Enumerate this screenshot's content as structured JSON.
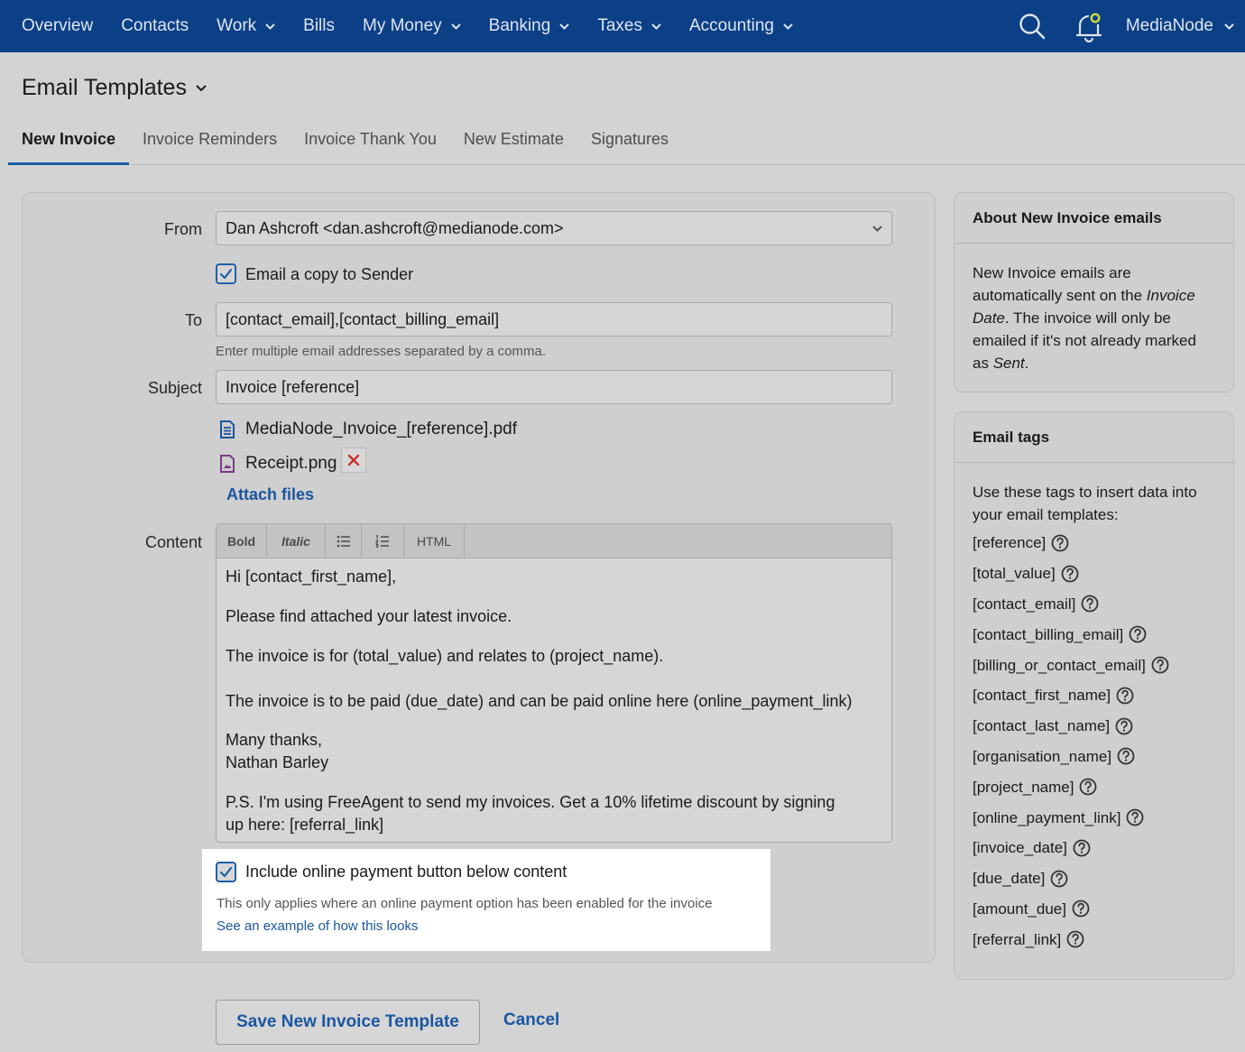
{
  "nav": {
    "items": [
      {
        "label": "Overview",
        "has_dropdown": false
      },
      {
        "label": "Contacts",
        "has_dropdown": false
      },
      {
        "label": "Work",
        "has_dropdown": true
      },
      {
        "label": "Bills",
        "has_dropdown": false
      },
      {
        "label": "My Money",
        "has_dropdown": true
      },
      {
        "label": "Banking",
        "has_dropdown": true
      },
      {
        "label": "Taxes",
        "has_dropdown": true
      },
      {
        "label": "Accounting",
        "has_dropdown": true
      }
    ],
    "user_label": "MediaNode",
    "icons": [
      "search-icon",
      "bell-icon",
      "chevron-down-icon"
    ],
    "colors": {
      "bar": "#0b3f86",
      "notification_dot": "#c8d83a"
    }
  },
  "page": {
    "title": "Email Templates"
  },
  "tabs": [
    {
      "label": "New Invoice",
      "active": true
    },
    {
      "label": "Invoice Reminders",
      "active": false
    },
    {
      "label": "Invoice Thank You",
      "active": false
    },
    {
      "label": "New Estimate",
      "active": false
    },
    {
      "label": "Signatures",
      "active": false
    }
  ],
  "form": {
    "from_label": "From",
    "from_value": "Dan Ashcroft <dan.ashcroft@medianode.com>",
    "copy_sender_label": "Email a copy to Sender",
    "copy_sender_checked": true,
    "to_label": "To",
    "to_value": "[contact_email],[contact_billing_email]",
    "to_hint": "Enter multiple email addresses separated by a comma.",
    "subject_label": "Subject",
    "subject_value": "Invoice [reference]",
    "attachments": [
      {
        "name": "MediaNode_Invoice_[reference].pdf",
        "icon": "document-icon",
        "removable": false
      },
      {
        "name": "Receipt.png",
        "icon": "image-file-icon",
        "removable": true
      }
    ],
    "attach_link": "Attach files",
    "content_label": "Content",
    "toolbar": {
      "bold": "Bold",
      "italic": "Italic",
      "bullet_list": "bullet-list-icon",
      "numbered_list": "numbered-list-icon",
      "html": "HTML"
    },
    "content": {
      "greeting": "Hi [contact_first_name],",
      "line1": "Please find attached your latest invoice.",
      "line2": "The invoice is for (total_value) and relates to (project_name).",
      "line3": "The invoice is to be paid (due_date) and can be paid online here (online_payment_link)",
      "signoff1": "Many thanks,",
      "signoff2": "Nathan Barley",
      "ps_line1": "P.S. I'm using FreeAgent to send my invoices. Get a 10% lifetime discount by signing",
      "ps_line2": "up here: [referral_link]"
    },
    "payment_button_label": "Include online payment button below content",
    "payment_button_checked": true,
    "payment_hint": "This only applies where an online payment option has been enabled for the invoice",
    "example_link": "See an example of how this looks"
  },
  "about": {
    "title": "About New Invoice emails",
    "text_1": "New Invoice emails are automatically sent on the ",
    "text_em1": "Invoice Date",
    "text_2": ". The invoice will only be emailed if it's not already marked as ",
    "text_em2": "Sent",
    "text_3": "."
  },
  "tags": {
    "title": "Email tags",
    "intro": "Use these tags to insert data into your email templates:",
    "items": [
      "[reference]",
      "[total_value]",
      "[contact_email]",
      "[contact_billing_email]",
      "[billing_or_contact_email]",
      "[contact_first_name]",
      "[contact_last_name]",
      "[organisation_name]",
      "[project_name]",
      "[online_payment_link]",
      "[invoice_date]",
      "[due_date]",
      "[amount_due]",
      "[referral_link]"
    ]
  },
  "actions": {
    "save": "Save New Invoice Template",
    "cancel": "Cancel"
  }
}
